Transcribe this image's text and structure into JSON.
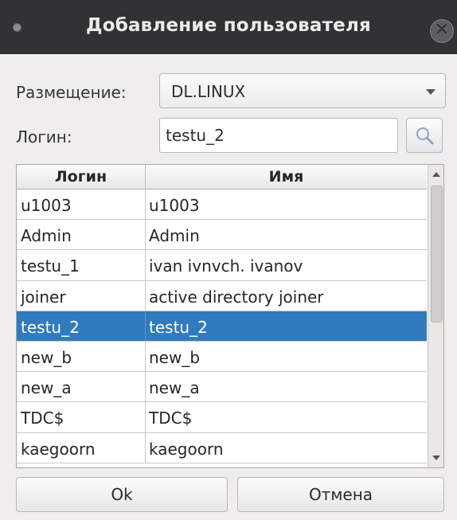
{
  "window": {
    "title": "Добавление пользователя",
    "close_icon": "close-icon"
  },
  "form": {
    "placement_label": "Размещение:",
    "placement_value": "DL.LINUX",
    "login_label": "Логин:",
    "login_value": "testu_2",
    "search_icon": "search-icon"
  },
  "table": {
    "columns": [
      "Логин",
      "Имя"
    ],
    "rows": [
      {
        "login": "u1003",
        "name": "u1003"
      },
      {
        "login": "Admin",
        "name": "Admin"
      },
      {
        "login": "testu_1",
        "name": "ivan ivnvch. ivanov"
      },
      {
        "login": "joiner",
        "name": "active directory joiner"
      },
      {
        "login": "testu_2",
        "name": "testu_2"
      },
      {
        "login": "new_b",
        "name": "new_b"
      },
      {
        "login": "new_a",
        "name": "new_a"
      },
      {
        "login": "TDC$",
        "name": "TDC$"
      },
      {
        "login": "kaegoorn",
        "name": "kaegoorn"
      }
    ],
    "selected_index": 4
  },
  "buttons": {
    "ok": "Ok",
    "cancel": "Отмена"
  },
  "colors": {
    "titlebar": "#303234",
    "selection": "#2f7bbd"
  }
}
